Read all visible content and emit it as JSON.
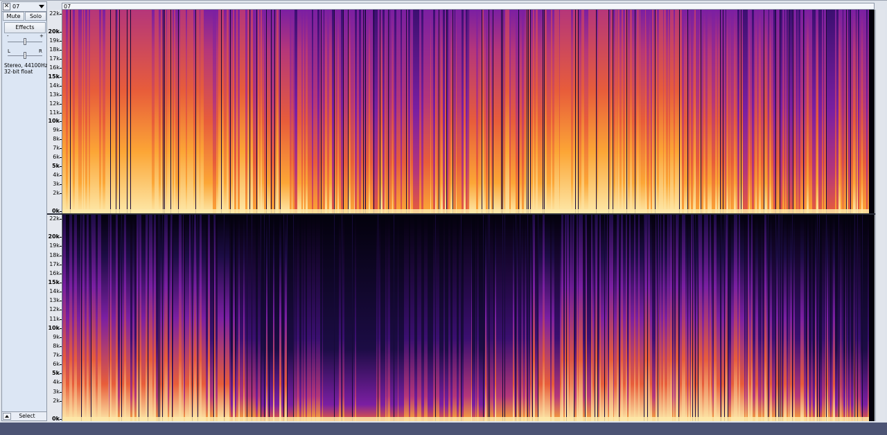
{
  "track": {
    "close_glyph": "✕",
    "name": "07",
    "mute_label": "Mute",
    "solo_label": "Solo",
    "effects_label": "Effects",
    "gain_minus": "-",
    "gain_plus": "+",
    "pan_left": "L",
    "pan_right": "R",
    "format_line1": "Stereo, 44100Hz",
    "format_line2": "32-bit float",
    "select_label": "Select"
  },
  "clip": {
    "name": "07"
  },
  "spectrogram": {
    "scale_labels": [
      "22k",
      "20k",
      "19k",
      "18k",
      "17k",
      "16k",
      "15k",
      "14k",
      "13k",
      "12k",
      "11k",
      "10k",
      "9k",
      "8k",
      "7k",
      "6k",
      "5k",
      "4k",
      "3k",
      "2k",
      "0k"
    ],
    "colormap": [
      "#03010c",
      "#1c0c45",
      "#3b0f70",
      "#7b1fa2",
      "#b5367a",
      "#e85d3a",
      "#fca636",
      "#fde8a8"
    ]
  }
}
